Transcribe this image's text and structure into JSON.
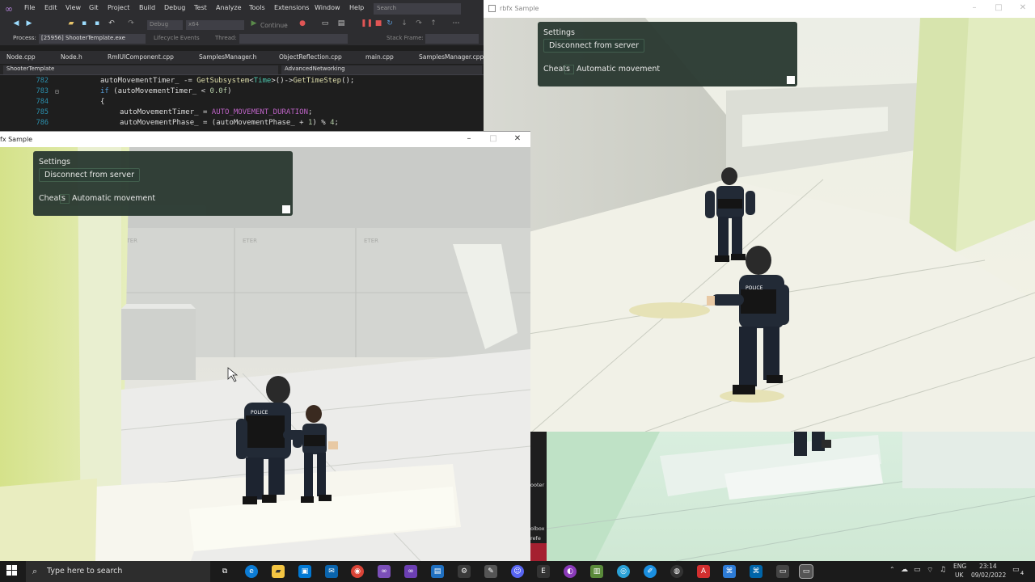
{
  "vs": {
    "menu": [
      "File",
      "Edit",
      "View",
      "Git",
      "Project",
      "Build",
      "Debug",
      "Test",
      "Analyze",
      "Tools",
      "Extensions",
      "Window",
      "Help"
    ],
    "search_placeholder": "Search",
    "toolbar": {
      "config": "Debug",
      "platform": "x64",
      "continue_label": "Continue"
    },
    "process": {
      "label": "Process:",
      "value": "[25956] ShooterTemplate.exe",
      "lifecycle": "Lifecycle Events",
      "thread": "Thread:",
      "stack_frame": "Stack Frame:"
    },
    "tabs": [
      "Node.cpp",
      "Node.h",
      "RmlUIComponent.cpp",
      "SamplesManager.h",
      "ObjectReflection.cpp",
      "main.cpp",
      "SamplesManager.cpp"
    ],
    "nav": {
      "project": "ShooterTemplate",
      "scope": "AdvancedNetworking"
    },
    "code": [
      {
        "num": "782",
        "text": "autoMovementTimer_ -= GetSubsystem<Time>()->GetTimeStep();"
      },
      {
        "num": "783",
        "text": "if (autoMovementTimer_ < 0.0f)"
      },
      {
        "num": "784",
        "text": "{"
      },
      {
        "num": "785",
        "text": "autoMovementTimer_ = AUTO_MOVEMENT_DURATION;"
      },
      {
        "num": "786",
        "text": "autoMovementPhase_ = (autoMovementPhase_ + 1) % 4;"
      }
    ]
  },
  "left_window": {
    "title": "fx Sample",
    "panel": {
      "title": "Settings",
      "disconnect_label": "Disconnect from server",
      "cheats_label": "Cheats",
      "auto_label": "Automatic movement"
    }
  },
  "right_window": {
    "title": "rbfx Sample",
    "panel": {
      "title": "Settings",
      "disconnect_label": "Disconnect from server",
      "cheats_label": "Cheats",
      "auto_label": "Automatic movement"
    }
  },
  "scene": {
    "police_label": "POLICE",
    "wall_label": "ETER"
  },
  "background_window": {
    "fragments": [
      "ooter",
      "olbox",
      "refe"
    ]
  },
  "taskbar": {
    "search_placeholder": "Type here to search",
    "lang_top": "ENG",
    "lang_bottom": "UK",
    "time": "23:14",
    "date": "09/02/2022",
    "notif_count": "4"
  }
}
